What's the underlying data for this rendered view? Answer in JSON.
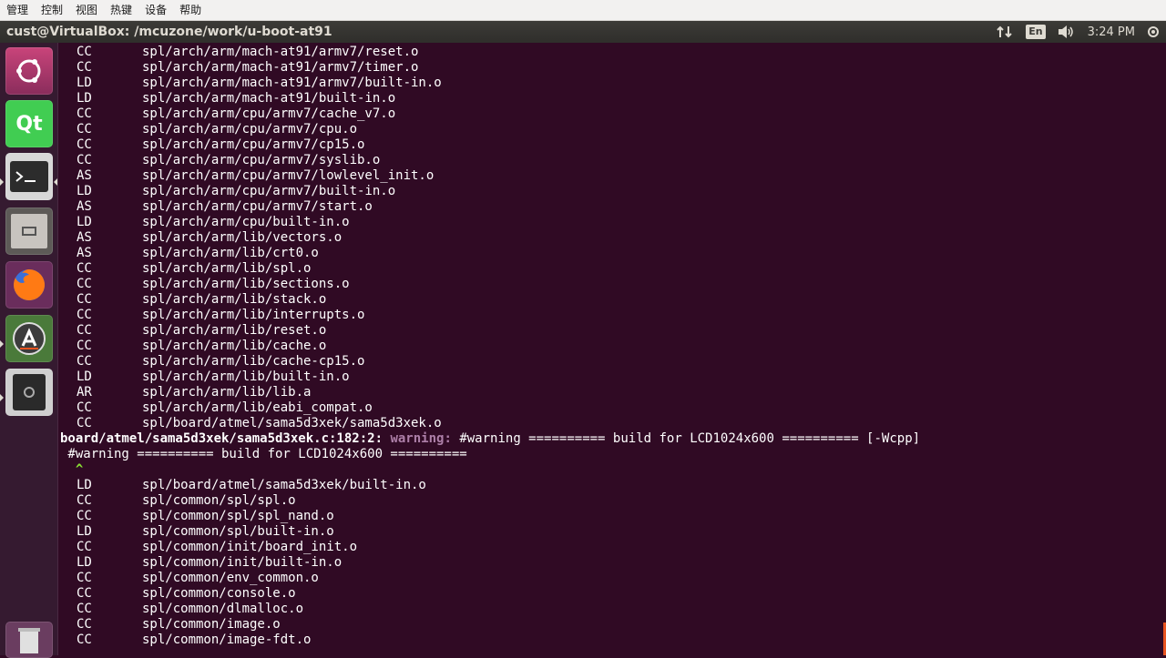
{
  "vbox_menu": [
    "管理",
    "控制",
    "视图",
    "热键",
    "设备",
    "帮助"
  ],
  "panel": {
    "window_title": "cust@VirtualBox: /mcuzone/work/u-boot-at91",
    "lang": "En",
    "clock": "3:24 PM"
  },
  "launcher": [
    {
      "name": "ubuntu-dash-icon",
      "color": "#e95420"
    },
    {
      "name": "qt-creator-icon",
      "color": "#41cd52",
      "label": "Qt"
    },
    {
      "name": "terminal-icon",
      "color": "#2c2c2c"
    },
    {
      "name": "files-icon",
      "color": "#8a8580"
    },
    {
      "name": "firefox-icon",
      "color": "#e66000"
    },
    {
      "name": "software-updater-icon",
      "color": "#5a5a5a"
    },
    {
      "name": "removable-drive-icon",
      "color": "#3a3a3a"
    },
    {
      "name": "trash-icon",
      "color": "#9a9a9a"
    }
  ],
  "terminal": {
    "lines_before": [
      {
        "cmd": "CC",
        "path": "spl/arch/arm/mach-at91/armv7/reset.o"
      },
      {
        "cmd": "CC",
        "path": "spl/arch/arm/mach-at91/armv7/timer.o"
      },
      {
        "cmd": "LD",
        "path": "spl/arch/arm/mach-at91/armv7/built-in.o"
      },
      {
        "cmd": "LD",
        "path": "spl/arch/arm/mach-at91/built-in.o"
      },
      {
        "cmd": "CC",
        "path": "spl/arch/arm/cpu/armv7/cache_v7.o"
      },
      {
        "cmd": "CC",
        "path": "spl/arch/arm/cpu/armv7/cpu.o"
      },
      {
        "cmd": "CC",
        "path": "spl/arch/arm/cpu/armv7/cp15.o"
      },
      {
        "cmd": "CC",
        "path": "spl/arch/arm/cpu/armv7/syslib.o"
      },
      {
        "cmd": "AS",
        "path": "spl/arch/arm/cpu/armv7/lowlevel_init.o"
      },
      {
        "cmd": "LD",
        "path": "spl/arch/arm/cpu/armv7/built-in.o"
      },
      {
        "cmd": "AS",
        "path": "spl/arch/arm/cpu/armv7/start.o"
      },
      {
        "cmd": "LD",
        "path": "spl/arch/arm/cpu/built-in.o"
      },
      {
        "cmd": "AS",
        "path": "spl/arch/arm/lib/vectors.o"
      },
      {
        "cmd": "AS",
        "path": "spl/arch/arm/lib/crt0.o"
      },
      {
        "cmd": "CC",
        "path": "spl/arch/arm/lib/spl.o"
      },
      {
        "cmd": "CC",
        "path": "spl/arch/arm/lib/sections.o"
      },
      {
        "cmd": "CC",
        "path": "spl/arch/arm/lib/stack.o"
      },
      {
        "cmd": "CC",
        "path": "spl/arch/arm/lib/interrupts.o"
      },
      {
        "cmd": "CC",
        "path": "spl/arch/arm/lib/reset.o"
      },
      {
        "cmd": "CC",
        "path": "spl/arch/arm/lib/cache.o"
      },
      {
        "cmd": "CC",
        "path": "spl/arch/arm/lib/cache-cp15.o"
      },
      {
        "cmd": "LD",
        "path": "spl/arch/arm/lib/built-in.o"
      },
      {
        "cmd": "AR",
        "path": "spl/arch/arm/lib/lib.a"
      },
      {
        "cmd": "CC",
        "path": "spl/arch/arm/lib/eabi_compat.o"
      },
      {
        "cmd": "CC",
        "path": "spl/board/atmel/sama5d3xek/sama5d3xek.o"
      }
    ],
    "warning": {
      "location": "board/atmel/sama5d3xek/sama5d3xek.c:182:2:",
      "keyword": "warning:",
      "message": "#warning ========== build for LCD1024x600 ========== [-Wcpp]",
      "source_line": " #warning ========== build for LCD1024x600 ==========",
      "caret": "  ^"
    },
    "lines_after": [
      {
        "cmd": "LD",
        "path": "spl/board/atmel/sama5d3xek/built-in.o"
      },
      {
        "cmd": "CC",
        "path": "spl/common/spl/spl.o"
      },
      {
        "cmd": "CC",
        "path": "spl/common/spl/spl_nand.o"
      },
      {
        "cmd": "LD",
        "path": "spl/common/spl/built-in.o"
      },
      {
        "cmd": "CC",
        "path": "spl/common/init/board_init.o"
      },
      {
        "cmd": "LD",
        "path": "spl/common/init/built-in.o"
      },
      {
        "cmd": "CC",
        "path": "spl/common/env_common.o"
      },
      {
        "cmd": "CC",
        "path": "spl/common/console.o"
      },
      {
        "cmd": "CC",
        "path": "spl/common/dlmalloc.o"
      },
      {
        "cmd": "CC",
        "path": "spl/common/image.o"
      },
      {
        "cmd": "CC",
        "path": "spl/common/image-fdt.o"
      }
    ]
  }
}
